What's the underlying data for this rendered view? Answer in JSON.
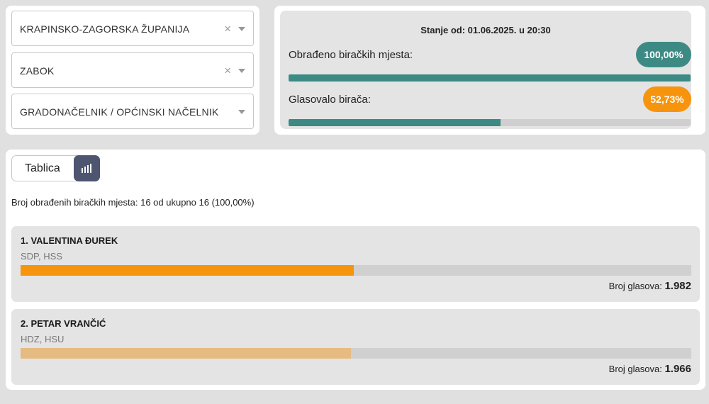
{
  "filters": {
    "county": "KRAPINSKO-ZAGORSKA ŽUPANIJA",
    "city": "ZABOK",
    "election_type": "GRADONAČELNIK / OPĆINSKI NAČELNIK",
    "clear_symbol": "×"
  },
  "status": {
    "date_text": "Stanje od: 01.06.2025. u 20:30",
    "processed_label": "Obrađeno biračkih mjesta:",
    "processed_value": "100,00%",
    "processed_percent": 100,
    "turnout_label": "Glasovalo birača:",
    "turnout_value": "52,73%",
    "turnout_percent": 52.73,
    "colors": {
      "teal": "#3d8a85",
      "orange": "#f7940d"
    }
  },
  "results": {
    "view_toggle_label": "Tablica",
    "view_toggle_icon": "bar-chart-icon",
    "summary": "Broj obrađenih biračkih mjesta: 16 od ukupno 16 (100,00%)",
    "votes_label": "Broj glasova:",
    "candidates": [
      {
        "name": "1. VALENTINA ĐUREK",
        "party": "SDP, HSS",
        "votes": "1.982",
        "vote_share": 49.7,
        "color": "#f7940d"
      },
      {
        "name": "2. PETAR VRANČIĆ",
        "party": "HDZ, HSU",
        "votes": "1.966",
        "vote_share": 49.3,
        "color": "#e5bb82"
      }
    ]
  }
}
